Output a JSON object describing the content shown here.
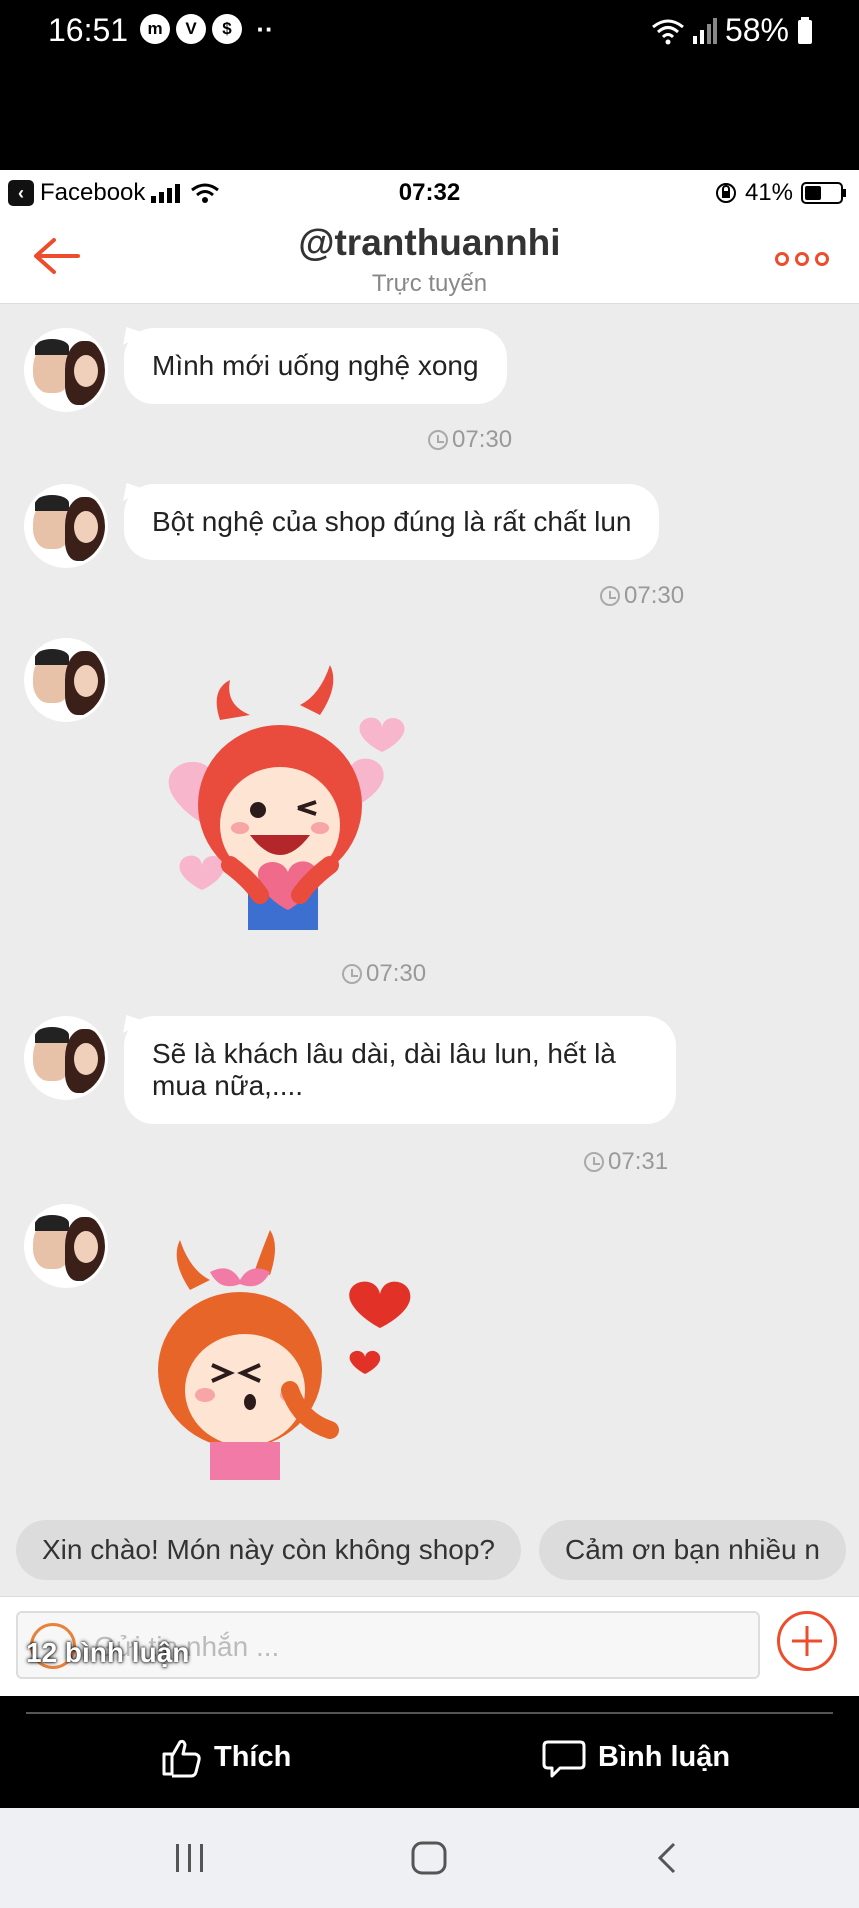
{
  "android_status": {
    "time": "16:51",
    "notif_badges": [
      "m",
      "V",
      "$"
    ],
    "notif_more": "··",
    "battery": "58%"
  },
  "ios_status": {
    "back_app": "Facebook",
    "time": "07:32",
    "battery": "41%"
  },
  "chat_header": {
    "title": "@tranthuannhi",
    "subtitle": "Trực tuyến"
  },
  "messages": [
    {
      "type": "text",
      "text": "Mình mới uống nghệ xong",
      "time": "07:30"
    },
    {
      "type": "text",
      "text": "Bột nghệ của shop đúng là rất chất lun",
      "time": "07:30"
    },
    {
      "type": "sticker",
      "sticker": "red-character-winking-with-heart",
      "time": "07:30"
    },
    {
      "type": "text",
      "text": "Sẽ là khách lâu dài, dài lâu lun, hết là mua nữa,....",
      "time": "07:31"
    },
    {
      "type": "sticker",
      "sticker": "orange-character-blowing-kiss-hearts"
    }
  ],
  "quick_replies": [
    "Xin chào! Món này còn không shop?",
    "Cảm ơn bạn nhiều n"
  ],
  "composer": {
    "placeholder": "Gửi tin nhắn ..."
  },
  "overlay": {
    "comments_count": "12 bình luận"
  },
  "fb_bar": {
    "like_label": "Thích",
    "comment_label": "Bình luận"
  },
  "colors": {
    "accent": "#ee4d2d",
    "chat_bg": "#ececec"
  },
  "icons": [
    "back-arrow-icon",
    "more-icon",
    "clock-icon",
    "emoji-icon",
    "plus-icon",
    "like-icon",
    "comment-icon",
    "recent-apps-icon",
    "home-icon",
    "back-nav-icon"
  ]
}
